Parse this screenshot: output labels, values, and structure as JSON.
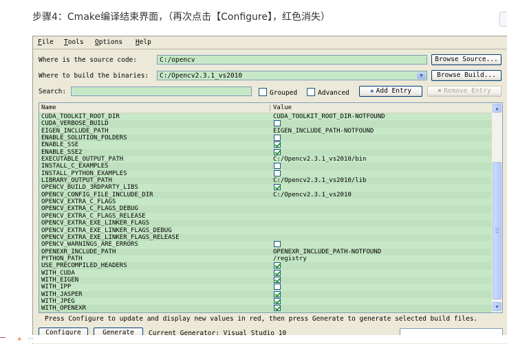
{
  "caption": "步骤4：Cmake编译结束界面，（再次点击【Configure】，红色消失）",
  "menu": [
    "File",
    "Tools",
    "Options",
    "Help"
  ],
  "source": {
    "label": "Where is the source code:",
    "value": "C:/opencv",
    "browse": "Browse Source..."
  },
  "build": {
    "label": "Where to build the binaries:",
    "value": "C:/Opencv2.3.1_vs2010",
    "browse": "Browse Build..."
  },
  "search": {
    "label": "Search:",
    "value": "",
    "grouped": "Grouped",
    "advanced": "Advanced",
    "add_entry": "Add Entry",
    "remove_entry": "Remove Entry"
  },
  "table": {
    "col_name": "Name",
    "col_value": "Value",
    "rows": [
      {
        "name": "CUDA_TOOLKIT_ROOT_DIR",
        "type": "text",
        "value": "CUDA_TOOLKIT_ROOT_DIR-NOTFOUND"
      },
      {
        "name": "CUDA_VERBOSE_BUILD",
        "type": "bool",
        "checked": false
      },
      {
        "name": "EIGEN_INCLUDE_PATH",
        "type": "text",
        "value": "EIGEN_INCLUDE_PATH-NOTFOUND"
      },
      {
        "name": "ENABLE_SOLUTION_FOLDERS",
        "type": "bool",
        "checked": false
      },
      {
        "name": "ENABLE_SSE",
        "type": "bool",
        "checked": true
      },
      {
        "name": "ENABLE_SSE2",
        "type": "bool",
        "checked": true
      },
      {
        "name": "EXECUTABLE_OUTPUT_PATH",
        "type": "text",
        "value": "C:/Opencv2.3.1_vs2010/bin"
      },
      {
        "name": "INSTALL_C_EXAMPLES",
        "type": "bool",
        "checked": false
      },
      {
        "name": "INSTALL_PYTHON_EXAMPLES",
        "type": "bool",
        "checked": false
      },
      {
        "name": "LIBRARY_OUTPUT_PATH",
        "type": "text",
        "value": "C:/Opencv2.3.1_vs2010/lib"
      },
      {
        "name": "OPENCV_BUILD_3RDPARTY_LIBS",
        "type": "bool",
        "checked": true
      },
      {
        "name": "OPENCV_CONFIG_FILE_INCLUDE_DIR",
        "type": "text",
        "value": "C:/Opencv2.3.1_vs2010"
      },
      {
        "name": "OPENCV_EXTRA_C_FLAGS",
        "type": "text",
        "value": ""
      },
      {
        "name": "OPENCV_EXTRA_C_FLAGS_DEBUG",
        "type": "text",
        "value": ""
      },
      {
        "name": "OPENCV_EXTRA_C_FLAGS_RELEASE",
        "type": "text",
        "value": ""
      },
      {
        "name": "OPENCV_EXTRA_EXE_LINKER_FLAGS",
        "type": "text",
        "value": ""
      },
      {
        "name": "OPENCV_EXTRA_EXE_LINKER_FLAGS_DEBUG",
        "type": "text",
        "value": ""
      },
      {
        "name": "OPENCV_EXTRA_EXE_LINKER_FLAGS_RELEASE",
        "type": "text",
        "value": ""
      },
      {
        "name": "OPENCV_WARNINGS_ARE_ERRORS",
        "type": "bool",
        "checked": false
      },
      {
        "name": "OPENEXR_INCLUDE_PATH",
        "type": "text",
        "value": "OPENEXR_INCLUDE_PATH-NOTFOUND"
      },
      {
        "name": "PYTHON_PATH",
        "type": "text",
        "value": "/registry"
      },
      {
        "name": "USE_PRECOMPILED_HEADERS",
        "type": "bool",
        "checked": true
      },
      {
        "name": "WITH_CUDA",
        "type": "bool",
        "checked": true
      },
      {
        "name": "WITH_EIGEN",
        "type": "bool",
        "checked": true
      },
      {
        "name": "WITH_IPP",
        "type": "bool",
        "checked": false
      },
      {
        "name": "WITH_JASPER",
        "type": "bool",
        "checked": true
      },
      {
        "name": "WITH_JPEG",
        "type": "bool",
        "checked": true
      },
      {
        "name": "WITH_OPENEXR",
        "type": "bool",
        "checked": true
      }
    ]
  },
  "status_text": "Press Configure to update and display new values in red, then press Generate to generate selected build files.",
  "bottom": {
    "configure": "Configure",
    "generate": "Generate",
    "generator": "Current Generator: Visual Studio 10"
  },
  "colors": {
    "row_bg": "#c7e8c7",
    "window_bg": "#ece9d8",
    "check": "#21a121"
  },
  "icons": {
    "add": "plus-icon",
    "remove": "x-icon",
    "scroll_up": "chevron-up-icon",
    "scroll_down": "chevron-down-icon",
    "combo": "chevron-down-icon"
  }
}
